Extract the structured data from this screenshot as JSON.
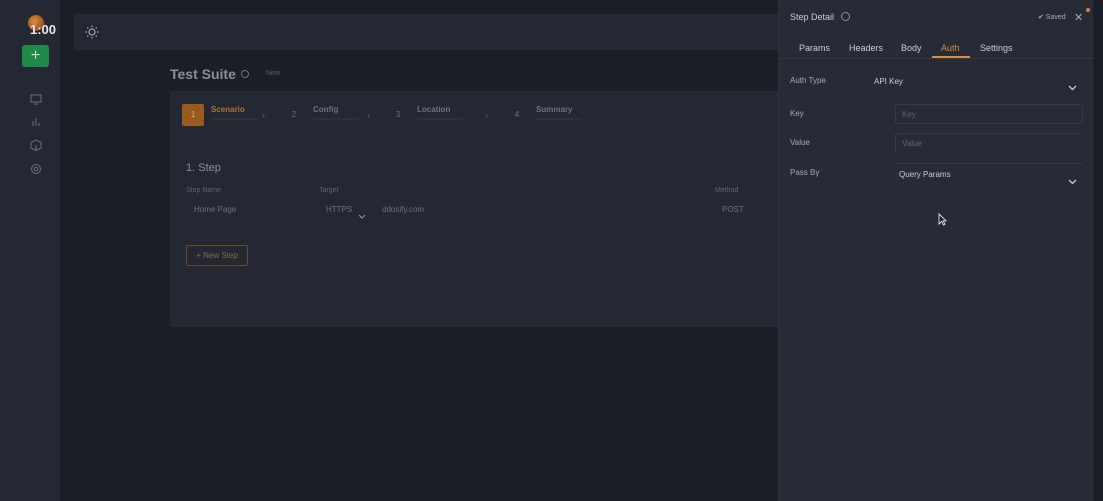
{
  "rail": {
    "timer": "1:00",
    "add_label": "+"
  },
  "main": {
    "title": "Test Suite",
    "title_tag": "New",
    "wizard": [
      {
        "num": "1",
        "label": "Scenario"
      },
      {
        "num": "2",
        "label": "Config"
      },
      {
        "num": "3",
        "label": "Location"
      },
      {
        "num": "4",
        "label": "Summary"
      }
    ],
    "section_title": "1. Step",
    "columns": {
      "step_name": "Step Name",
      "target": "Target",
      "method": "Method"
    },
    "row": {
      "step_name": "Home Page",
      "protocol": "HTTPS",
      "url": "ddosify.com",
      "method": "POST"
    },
    "new_step_label": "+ New Step"
  },
  "panel": {
    "title": "Step Detail",
    "saved_label": "✔ Saved",
    "close_label": "✕",
    "tabs": [
      {
        "label": "Params"
      },
      {
        "label": "Headers"
      },
      {
        "label": "Body"
      },
      {
        "label": "Auth"
      },
      {
        "label": "Settings"
      }
    ],
    "auth_type_label": "Auth Type",
    "auth_type_value": "API Key",
    "key_label": "Key",
    "key_placeholder": "Key",
    "value_label": "Value",
    "value_placeholder": "Value",
    "pass_by_label": "Pass By",
    "pass_by_value": "Query Params"
  },
  "colors": {
    "accent": "#e08a3a",
    "add_button": "#1f8a4a",
    "background": "#1a1e27",
    "panel": "#262b36"
  }
}
